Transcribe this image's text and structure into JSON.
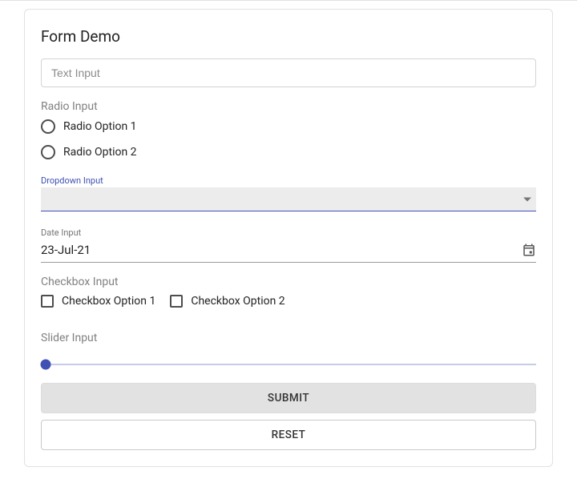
{
  "title": "Form Demo",
  "textInput": {
    "placeholder": "Text Input",
    "value": ""
  },
  "radio": {
    "label": "Radio Input",
    "options": [
      "Radio Option 1",
      "Radio Option 2"
    ]
  },
  "dropdown": {
    "label": "Dropdown Input",
    "value": ""
  },
  "date": {
    "label": "Date Input",
    "value": "23-Jul-21"
  },
  "checkbox": {
    "label": "Checkbox Input",
    "options": [
      "Checkbox Option 1",
      "Checkbox Option 2"
    ]
  },
  "slider": {
    "label": "Slider Input"
  },
  "buttons": {
    "submit": "SUBMIT",
    "reset": "RESET"
  }
}
